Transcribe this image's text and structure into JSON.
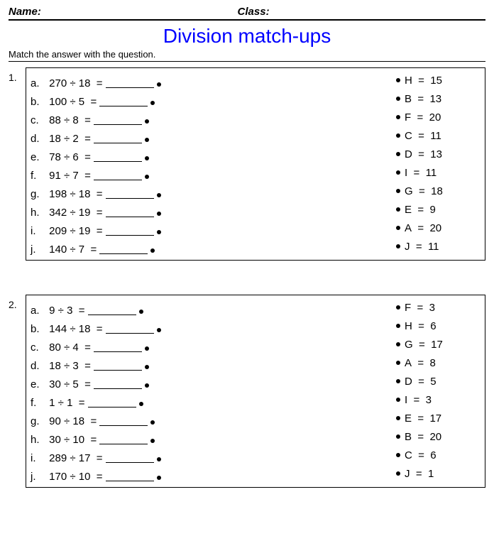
{
  "header": {
    "name_label": "Name:",
    "class_label": "Class:"
  },
  "title": "Division match-ups",
  "instructions": "Match the answer with the question.",
  "sets": [
    {
      "number": "1.",
      "questions": [
        {
          "letter": "a.",
          "expr": "270 ÷ 18  ="
        },
        {
          "letter": "b.",
          "expr": "100 ÷ 5  ="
        },
        {
          "letter": "c.",
          "expr": "88 ÷ 8  ="
        },
        {
          "letter": "d.",
          "expr": "18 ÷ 2  ="
        },
        {
          "letter": "e.",
          "expr": "78 ÷ 6  ="
        },
        {
          "letter": "f.",
          "expr": "91 ÷ 7  ="
        },
        {
          "letter": "g.",
          "expr": "198 ÷ 18  ="
        },
        {
          "letter": "h.",
          "expr": "342 ÷ 19  ="
        },
        {
          "letter": "i.",
          "expr": "209 ÷ 19  ="
        },
        {
          "letter": "j.",
          "expr": "140 ÷ 7  ="
        }
      ],
      "answers": [
        {
          "letter": "H",
          "value": "15"
        },
        {
          "letter": "B",
          "value": "13"
        },
        {
          "letter": "F",
          "value": "20"
        },
        {
          "letter": "C",
          "value": "11"
        },
        {
          "letter": "D",
          "value": "13"
        },
        {
          "letter": "I",
          "value": "11"
        },
        {
          "letter": "G",
          "value": "18"
        },
        {
          "letter": "E",
          "value": "9"
        },
        {
          "letter": "A",
          "value": "20"
        },
        {
          "letter": "J",
          "value": "11"
        }
      ]
    },
    {
      "number": "2.",
      "questions": [
        {
          "letter": "a.",
          "expr": "9 ÷ 3  ="
        },
        {
          "letter": "b.",
          "expr": "144 ÷ 18  ="
        },
        {
          "letter": "c.",
          "expr": "80 ÷ 4  ="
        },
        {
          "letter": "d.",
          "expr": "18 ÷ 3  ="
        },
        {
          "letter": "e.",
          "expr": "30 ÷ 5  ="
        },
        {
          "letter": "f.",
          "expr": "1 ÷ 1  ="
        },
        {
          "letter": "g.",
          "expr": "90 ÷ 18  ="
        },
        {
          "letter": "h.",
          "expr": "30 ÷ 10  ="
        },
        {
          "letter": "i.",
          "expr": "289 ÷ 17  ="
        },
        {
          "letter": "j.",
          "expr": "170 ÷ 10  ="
        }
      ],
      "answers": [
        {
          "letter": "F",
          "value": "3"
        },
        {
          "letter": "H",
          "value": "6"
        },
        {
          "letter": "G",
          "value": "17"
        },
        {
          "letter": "A",
          "value": "8"
        },
        {
          "letter": "D",
          "value": "5"
        },
        {
          "letter": "I",
          "value": "3"
        },
        {
          "letter": "E",
          "value": "17"
        },
        {
          "letter": "B",
          "value": "20"
        },
        {
          "letter": "C",
          "value": "6"
        },
        {
          "letter": "J",
          "value": "1"
        }
      ]
    }
  ]
}
